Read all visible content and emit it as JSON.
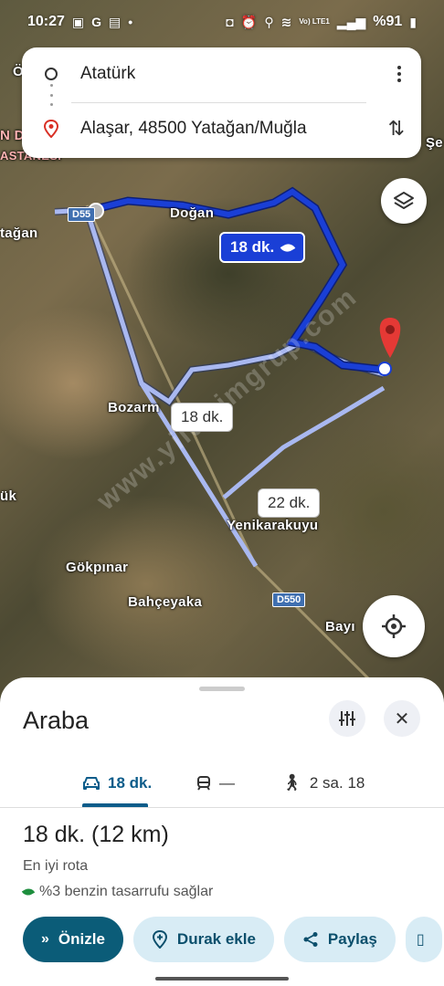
{
  "status_bar": {
    "time": "10:27",
    "battery": "%91",
    "network_label": "Vo) LTE1"
  },
  "search": {
    "origin": "Atatürk",
    "destination": "Alaşar, 48500 Yatağan/Muğla"
  },
  "map": {
    "labels": {
      "dogan": "Doğan",
      "yatagan": "tağan",
      "bozarm": "Bozarm",
      "yenikarakuyu": "Yenikarakuyu",
      "gokpinar": "Gökpınar",
      "bahceyaka": "Bahçeyaka",
      "bayi": "Bayı",
      "uk": "ük",
      "se": "Şe",
      "astanesi": "ASTANESİ",
      "nd": "N D",
      "o_top": "Ö"
    },
    "road_signs": {
      "d550_top": "D55",
      "d550_bottom": "D550"
    },
    "route_times": {
      "main": "18 dk.",
      "alt1": "18 dk.",
      "alt2": "22 dk."
    },
    "watermark": "www.yildirimgrup.com",
    "colors": {
      "main_route": "#1a3fd6",
      "alt_route": "#a9b8f0"
    }
  },
  "sheet": {
    "title": "Araba",
    "tabs": [
      {
        "label": "18 dk.",
        "icon": "car-icon"
      },
      {
        "label": "—",
        "icon": "train-icon"
      },
      {
        "label": "2 sa. 18",
        "icon": "walk-icon"
      }
    ],
    "route_time": "18 dk. (12 km)",
    "route_desc": "En iyi rota",
    "fuel_note": "%3 benzin tasarrufu sağlar",
    "actions": {
      "preview": "Önizle",
      "add_stop": "Durak ekle",
      "share": "Paylaş"
    }
  }
}
